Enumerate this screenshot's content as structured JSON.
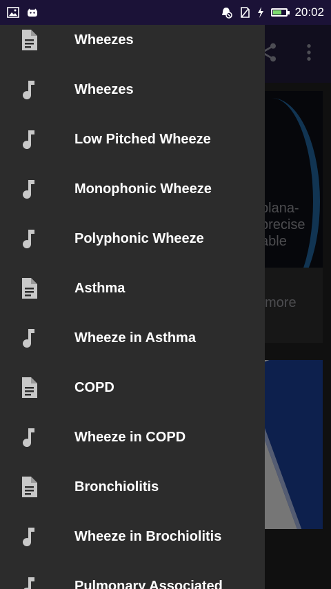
{
  "status_bar": {
    "time": "20:02",
    "left_icons": [
      "image-icon",
      "android-icon"
    ],
    "right_icons": [
      "alarm-icon",
      "no-sim-icon",
      "charging-icon",
      "battery-icon"
    ]
  },
  "drawer": {
    "items": [
      {
        "label": "Wheezes",
        "icon": "document-icon"
      },
      {
        "label": "Wheezes",
        "icon": "music-note-icon"
      },
      {
        "label": "Low Pitched Wheeze",
        "icon": "music-note-icon"
      },
      {
        "label": "Monophonic Wheeze",
        "icon": "music-note-icon"
      },
      {
        "label": "Polyphonic Wheeze",
        "icon": "music-note-icon"
      },
      {
        "label": "Asthma",
        "icon": "document-icon"
      },
      {
        "label": "Wheeze in Asthma",
        "icon": "music-note-icon"
      },
      {
        "label": "COPD",
        "icon": "document-icon"
      },
      {
        "label": "Wheeze in COPD",
        "icon": "music-note-icon"
      },
      {
        "label": "Bronchiolitis",
        "icon": "document-icon"
      },
      {
        "label": "Wheeze in Brochiolitis",
        "icon": "music-note-icon"
      },
      {
        "label": "Pulmonary Associated",
        "icon": "music-note-icon"
      }
    ]
  },
  "background": {
    "card1_text": "plana-\nprecise\nable",
    "card1_more": "more"
  },
  "colors": {
    "status_bar": "#1b1237",
    "drawer_bg": "#2c2c2c",
    "icon_gray": "#c8c8c8"
  }
}
